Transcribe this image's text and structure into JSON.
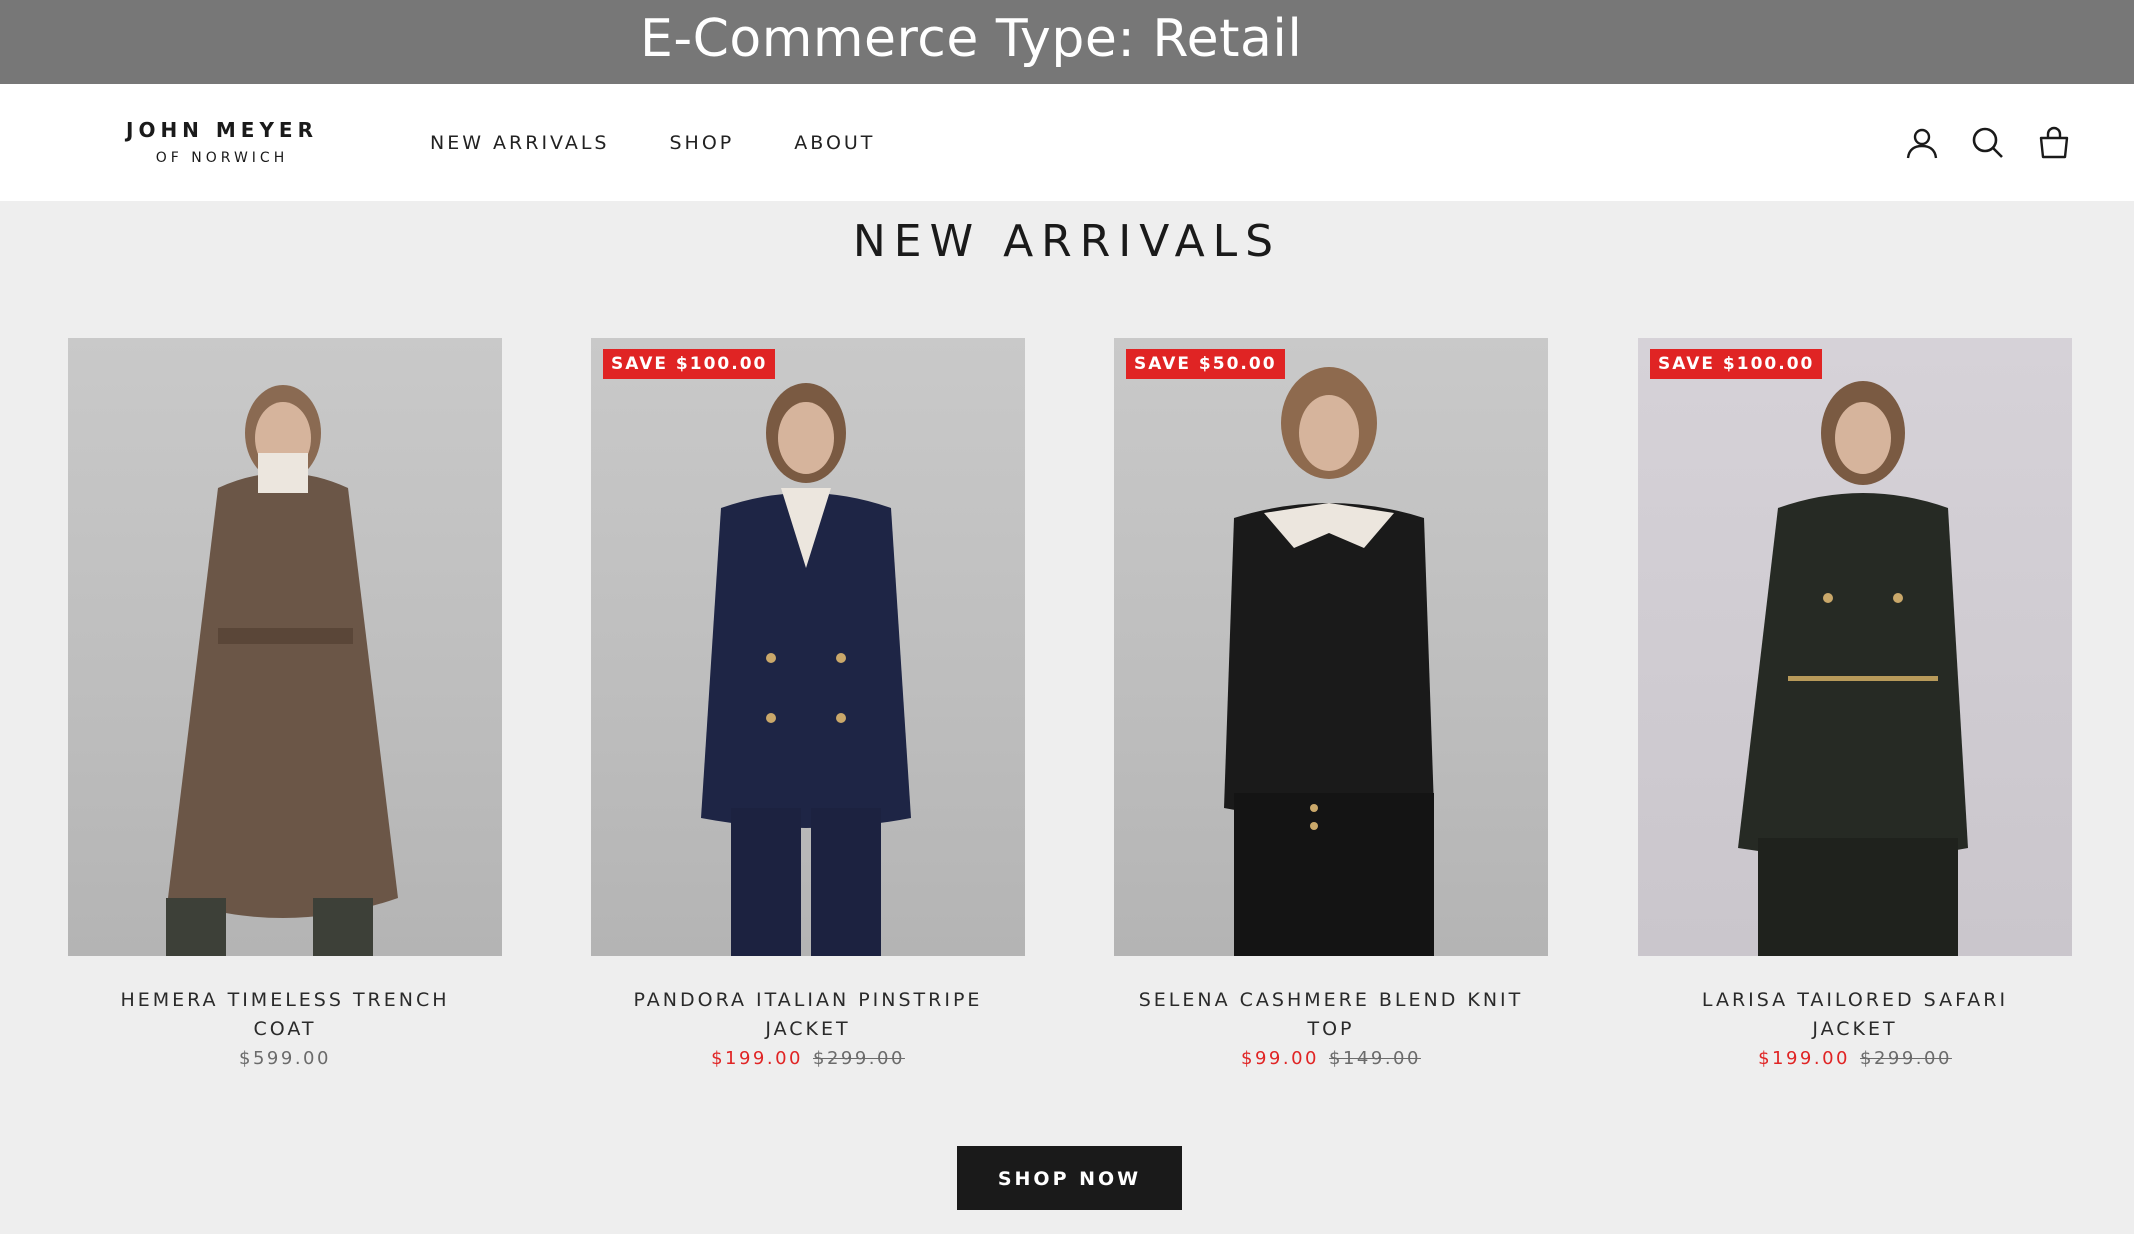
{
  "banner": {
    "title": "E-Commerce Type: Retail"
  },
  "header": {
    "logo": {
      "name": "JOHN MEYER",
      "sub": "OF NORWICH"
    },
    "nav": [
      {
        "label": "NEW ARRIVALS"
      },
      {
        "label": "SHOP"
      },
      {
        "label": "ABOUT"
      }
    ],
    "icons": [
      "account-icon",
      "search-icon",
      "cart-icon"
    ]
  },
  "main": {
    "title": "NEW ARRIVALS",
    "products": [
      {
        "name": "HEMERA TIMELESS TRENCH COAT",
        "badge": "",
        "price": "$599.00",
        "sale_price": "",
        "old_price": "",
        "garment_color": "#6b5647"
      },
      {
        "name": "PANDORA ITALIAN PINSTRIPE JACKET",
        "badge": "SAVE $100.00",
        "price": "",
        "sale_price": "$199.00",
        "old_price": "$299.00",
        "garment_color": "#1e2545"
      },
      {
        "name": "SELENA CASHMERE BLEND KNIT TOP",
        "badge": "SAVE $50.00",
        "price": "",
        "sale_price": "$99.00",
        "old_price": "$149.00",
        "garment_color": "#1a1a1a"
      },
      {
        "name": "LARISA TAILORED SAFARI JACKET",
        "badge": "SAVE $100.00",
        "price": "",
        "sale_price": "$199.00",
        "old_price": "$299.00",
        "garment_color": "#262a24"
      }
    ],
    "cta": "SHOP NOW"
  },
  "colors": {
    "banner_bg": "#777777",
    "sale_red": "#e02424",
    "page_bg": "#eeeeee",
    "button_bg": "#1a1a1a"
  }
}
